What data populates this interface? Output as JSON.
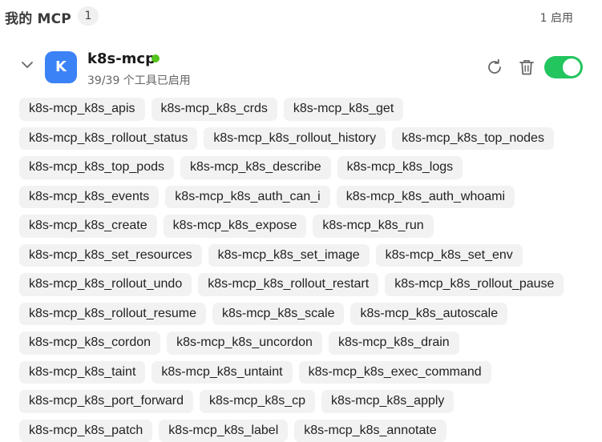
{
  "header": {
    "title": "我的 MCP",
    "count": "1",
    "enabled": "1 启用"
  },
  "server": {
    "avatar_letter": "K",
    "name": "k8s-mcp",
    "subtitle": "39/39 个工具已启用",
    "status_color": "#52c41a",
    "enabled": true
  },
  "tools": [
    "k8s-mcp_k8s_apis",
    "k8s-mcp_k8s_crds",
    "k8s-mcp_k8s_get",
    "k8s-mcp_k8s_rollout_status",
    "k8s-mcp_k8s_rollout_history",
    "k8s-mcp_k8s_top_nodes",
    "k8s-mcp_k8s_top_pods",
    "k8s-mcp_k8s_describe",
    "k8s-mcp_k8s_logs",
    "k8s-mcp_k8s_events",
    "k8s-mcp_k8s_auth_can_i",
    "k8s-mcp_k8s_auth_whoami",
    "k8s-mcp_k8s_create",
    "k8s-mcp_k8s_expose",
    "k8s-mcp_k8s_run",
    "k8s-mcp_k8s_set_resources",
    "k8s-mcp_k8s_set_image",
    "k8s-mcp_k8s_set_env",
    "k8s-mcp_k8s_rollout_undo",
    "k8s-mcp_k8s_rollout_restart",
    "k8s-mcp_k8s_rollout_pause",
    "k8s-mcp_k8s_rollout_resume",
    "k8s-mcp_k8s_scale",
    "k8s-mcp_k8s_autoscale",
    "k8s-mcp_k8s_cordon",
    "k8s-mcp_k8s_uncordon",
    "k8s-mcp_k8s_drain",
    "k8s-mcp_k8s_taint",
    "k8s-mcp_k8s_untaint",
    "k8s-mcp_k8s_exec_command",
    "k8s-mcp_k8s_port_forward",
    "k8s-mcp_k8s_cp",
    "k8s-mcp_k8s_apply",
    "k8s-mcp_k8s_patch",
    "k8s-mcp_k8s_label",
    "k8s-mcp_k8s_annotate"
  ]
}
